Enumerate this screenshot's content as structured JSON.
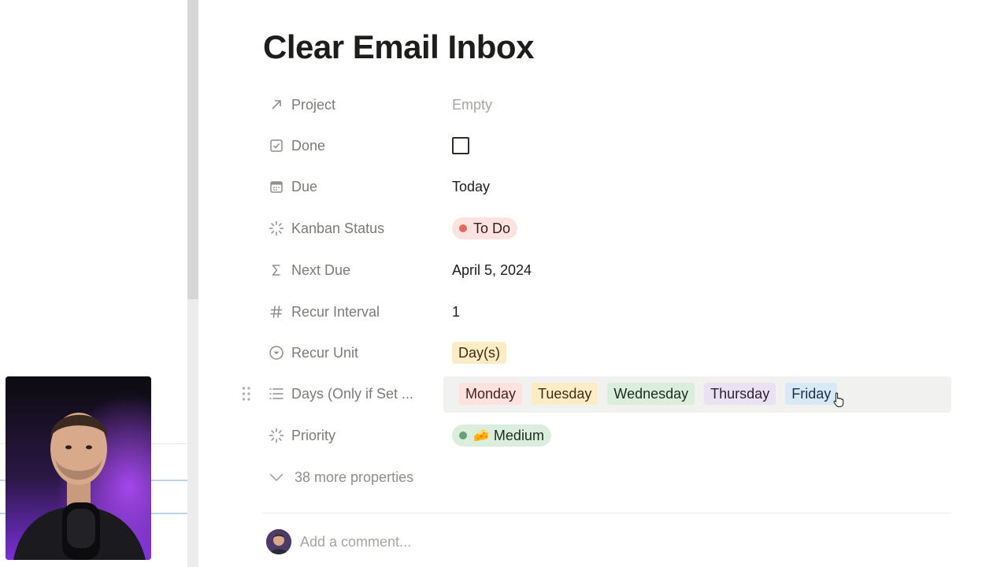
{
  "page": {
    "title": "Clear Email Inbox"
  },
  "properties": [
    {
      "name": "Project",
      "icon": "arrow-up-right-icon",
      "value": "Empty"
    },
    {
      "name": "Done",
      "icon": "checkbox-icon",
      "value_checked": false
    },
    {
      "name": "Due",
      "icon": "calendar-icon",
      "value": "Today"
    },
    {
      "name": "Kanban Status",
      "icon": "status-icon",
      "value": "To Do"
    },
    {
      "name": "Next Due",
      "icon": "sigma-icon",
      "value": "April 5, 2024"
    },
    {
      "name": "Recur Interval",
      "icon": "hash-icon",
      "value": "1"
    },
    {
      "name": "Recur Unit",
      "icon": "select-icon",
      "value": "Day(s)"
    },
    {
      "name": "Days (Only if Set ...",
      "icon": "list-icon",
      "values": [
        "Monday",
        "Tuesday",
        "Wednesday",
        "Thursday",
        "Friday"
      ]
    },
    {
      "name": "Priority",
      "icon": "status-icon",
      "value": "Medium",
      "emoji": "🧀"
    }
  ],
  "more_properties": "38 more properties",
  "comment": {
    "placeholder": "Add a comment..."
  },
  "colors": {
    "todo_dot": "#e06a60",
    "medium_dot": "#6b9e71",
    "hover_row": "#f1f1ef"
  }
}
